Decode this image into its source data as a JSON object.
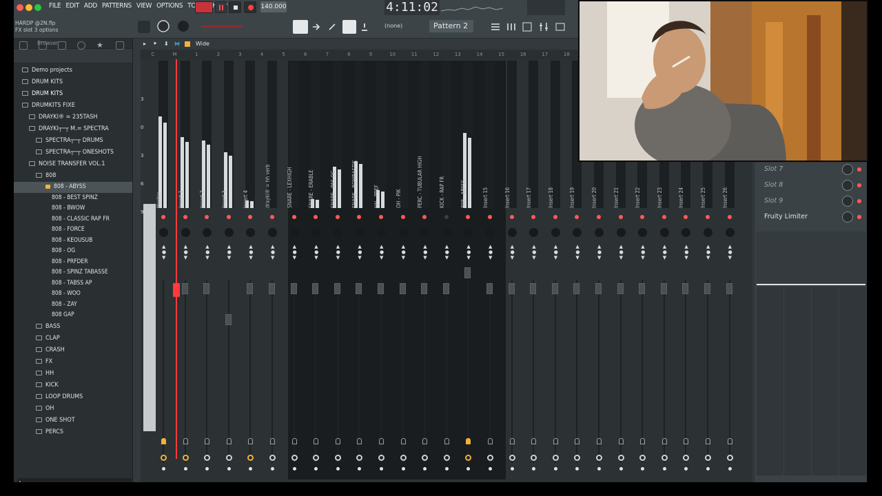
{
  "app": {
    "menu": [
      "FILE",
      "EDIT",
      "ADD",
      "PATTERNS",
      "VIEW",
      "OPTIONS",
      "TOOLS",
      "HELP"
    ],
    "tempo": "140.000",
    "time": "4:11:02",
    "hint_title": "HARDP @2N.flp",
    "hint_sub": "FX slot 3 options",
    "pattern_label": "Pattern 2",
    "channel_select": "(none)",
    "mixer_view": "Wide",
    "browser_title": "Browser"
  },
  "browser": {
    "items": [
      {
        "label": "Demo projects",
        "level": 0
      },
      {
        "label": "DRUM KITS",
        "level": 0
      },
      {
        "label": "DRUM KITS",
        "level": 0
      },
      {
        "label": "DRUMKITS FIXE",
        "level": 0
      },
      {
        "label": "DRAYKI® = 235TASH",
        "level": 1
      },
      {
        "label": "DRAYKI┬─┬ M.= SPECTRA",
        "level": 1
      },
      {
        "label": "SPECTRA┬─┬ DRUMS",
        "level": 2
      },
      {
        "label": "SPECTRA┬─┬ ONESHOTS",
        "level": 2
      },
      {
        "label": "NOISE TRANSFER VOL.1",
        "level": 1
      },
      {
        "label": "808",
        "level": 2
      }
    ],
    "subitems": [
      "808 - ABYSS",
      "808 - BEST SPINZ",
      "808 - BWOW",
      "808 - CLASSIC RAP FR",
      "808 - FORCE",
      "808 - KEOUSUB",
      "808 - OG",
      "808 - PRFDER",
      "808 - SPINZ TABASSE",
      "808 - TABSS AP",
      "808 - WOO",
      "808 - ZAY",
      "808 GAP"
    ],
    "folders": [
      "BASS",
      "CLAP",
      "CRASH",
      "FX",
      "HH",
      "KICK",
      "LOOP DRUMS",
      "OH",
      "ONE SHOT",
      "PERCS"
    ]
  },
  "mixer": {
    "scale": [
      "3",
      "0",
      "3",
      "6",
      "9"
    ],
    "tracks": [
      "Master",
      "Insert 1",
      "Insert 2",
      "Insert 3",
      "Insert 4",
      "drayki® = hh verb",
      "SNARE - LEXHIGH",
      "SNARE - ERABLE",
      "SNARE - PAS OG",
      "SNARE - BOMBASTIK",
      "HH - PREF",
      "OH - PIK",
      "PERC - TUBULAR HIGH",
      "KICK - RAP FR",
      "808 - ABYSS",
      "Insert 15",
      "Insert 16",
      "Insert 17",
      "Insert 18",
      "Insert 19",
      "Insert 20",
      "Insert 21",
      "Insert 22",
      "Insert 23",
      "Insert 24",
      "Insert 25",
      "Insert 26"
    ],
    "numbers": [
      "C",
      "M",
      "1",
      "2",
      "3",
      "4",
      "5",
      "6",
      "7",
      "8",
      "9",
      "10",
      "11",
      "12",
      "13",
      "14",
      "15",
      "16",
      "17",
      "18",
      "19",
      "20",
      "21",
      "22",
      "23",
      "24",
      "25",
      "26"
    ]
  },
  "fx_slots": [
    "Slot 7",
    "Slot 8",
    "Slot 9",
    "Fruity Limiter"
  ],
  "colors": {
    "accent": "#ff3b3b",
    "panel": "#33393d",
    "highlight": "#f3b13a"
  }
}
